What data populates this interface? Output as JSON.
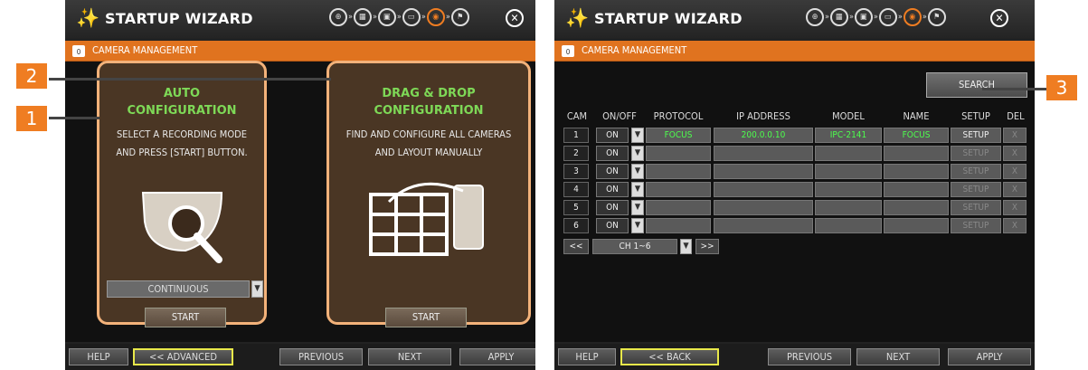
{
  "left": {
    "title": "STARTUP WIZARD",
    "section": "CAMERA MANAGEMENT",
    "auto": {
      "title1": "AUTO",
      "title2": "CONFIGURATION",
      "desc1": "SELECT A RECORDING MODE",
      "desc2": "AND PRESS [START] BUTTON.",
      "mode": "CONTINUOUS",
      "start": "START"
    },
    "drag": {
      "title1": "DRAG & DROP",
      "title2": "CONFIGURATION",
      "desc1": "FIND AND CONFIGURE ALL CAMERAS",
      "desc2": "AND LAYOUT MANUALLY",
      "start": "START"
    },
    "buttons": {
      "help": "HELP",
      "advanced": "<< ADVANCED",
      "previous": "PREVIOUS",
      "next": "NEXT",
      "apply": "APPLY"
    }
  },
  "right": {
    "title": "STARTUP WIZARD",
    "section": "CAMERA MANAGEMENT",
    "search": "SEARCH",
    "headers": [
      "CAM",
      "ON/OFF",
      "PROTOCOL",
      "IP ADDRESS",
      "MODEL",
      "NAME",
      "SETUP",
      "DEL"
    ],
    "rows": [
      {
        "cam": "1",
        "on": "ON",
        "protocol": "FOCUS",
        "ip": "200.0.0.10",
        "model": "IPC-2141",
        "name": "FOCUS",
        "setup": "SETUP",
        "del": "X"
      },
      {
        "cam": "2",
        "on": "ON",
        "protocol": "",
        "ip": "",
        "model": "",
        "name": "",
        "setup": "SETUP",
        "del": "X"
      },
      {
        "cam": "3",
        "on": "ON",
        "protocol": "",
        "ip": "",
        "model": "",
        "name": "",
        "setup": "SETUP",
        "del": "X"
      },
      {
        "cam": "4",
        "on": "ON",
        "protocol": "",
        "ip": "",
        "model": "",
        "name": "",
        "setup": "SETUP",
        "del": "X"
      },
      {
        "cam": "5",
        "on": "ON",
        "protocol": "",
        "ip": "",
        "model": "",
        "name": "",
        "setup": "SETUP",
        "del": "X"
      },
      {
        "cam": "6",
        "on": "ON",
        "protocol": "",
        "ip": "",
        "model": "",
        "name": "",
        "setup": "SETUP",
        "del": "X"
      }
    ],
    "pager": {
      "prev": "<<",
      "channel": "CH 1~6",
      "next": ">>"
    },
    "buttons": {
      "help": "HELP",
      "back": "<< BACK",
      "previous": "PREVIOUS",
      "next": "NEXT",
      "apply": "APPLY"
    }
  },
  "callouts": [
    "1",
    "2",
    "3"
  ],
  "icons": {
    "wizard": "magic-wand-icon",
    "close": "close-icon",
    "steps": [
      "network-icon",
      "calendar-icon",
      "disk-icon",
      "monitor-icon",
      "camera-icon",
      "finish-flag-icon"
    ]
  },
  "colors": {
    "accent": "#ef7d22",
    "card_border": "#f3b27a",
    "green_text": "#7ed957",
    "yellow_border": "#e8e84a"
  }
}
